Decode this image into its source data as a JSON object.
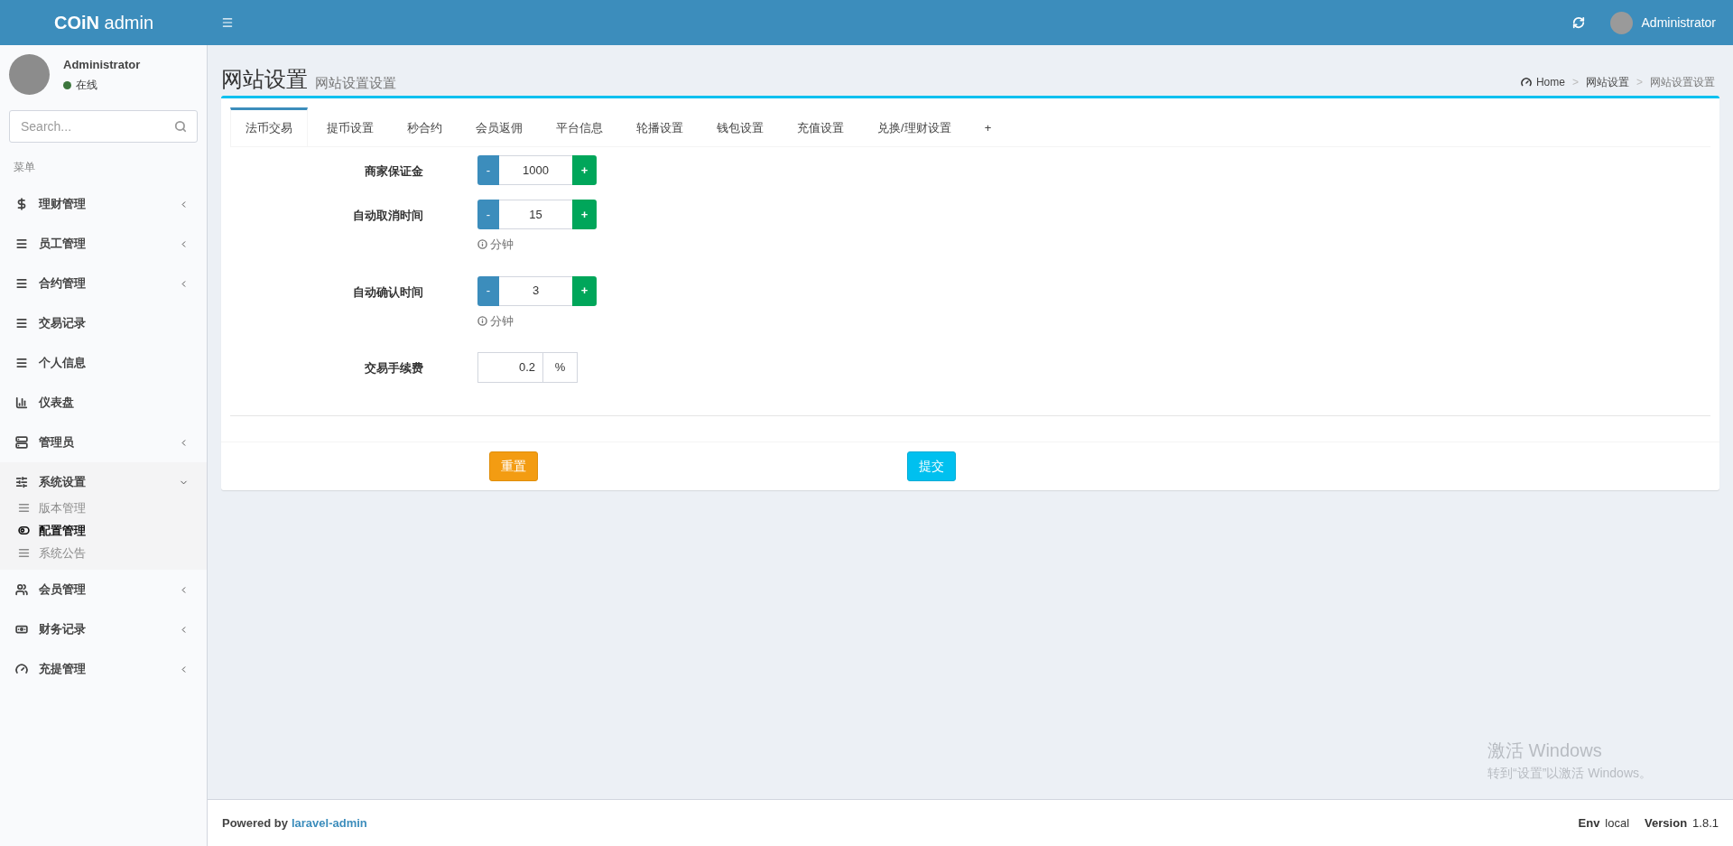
{
  "header": {
    "logo_bold": "COiN",
    "logo_text": "admin",
    "user": "Administrator"
  },
  "sidebar": {
    "user": {
      "name": "Administrator",
      "status": "在线",
      "online": true
    },
    "search": {
      "placeholder": "Search..."
    },
    "menu_heading": "菜单",
    "items": [
      {
        "label": "理财管理",
        "expanded": false
      },
      {
        "label": "员工管理",
        "expanded": false
      },
      {
        "label": "合约管理",
        "expanded": false
      },
      {
        "label": "交易记录"
      },
      {
        "label": "个人信息"
      },
      {
        "label": "仪表盘"
      },
      {
        "label": "管理员",
        "expanded": false
      },
      {
        "label": "系统设置",
        "expanded": true,
        "children": [
          {
            "label": "版本管理",
            "selected": false
          },
          {
            "label": "配置管理",
            "selected": true
          },
          {
            "label": "系统公告",
            "selected": false
          }
        ]
      },
      {
        "label": "会员管理",
        "expanded": false
      },
      {
        "label": "财务记录",
        "expanded": false
      },
      {
        "label": "充提管理",
        "expanded": false
      }
    ]
  },
  "page": {
    "title": "网站设置",
    "subtitle": "网站设置设置",
    "breadcrumb": [
      {
        "label": "Home"
      },
      {
        "label": "网站设置"
      },
      {
        "label": "网站设置设置"
      }
    ],
    "breadcrumb_separators": [
      ">",
      ">"
    ]
  },
  "tabs": [
    {
      "label": "法币交易",
      "selected": true
    },
    {
      "label": "提币设置",
      "selected": false
    },
    {
      "label": "秒合约",
      "selected": false
    },
    {
      "label": "会员返佣",
      "selected": false
    },
    {
      "label": "平台信息",
      "selected": false
    },
    {
      "label": "轮播设置",
      "selected": false
    },
    {
      "label": "钱包设置",
      "selected": false
    },
    {
      "label": "充值设置",
      "selected": false
    },
    {
      "label": "兑换/理财设置",
      "selected": false
    },
    {
      "label": "+",
      "selected": false
    }
  ],
  "fields": [
    {
      "kind": "stepper",
      "label": "商家保证金",
      "value": "1000",
      "minus": "-",
      "plus": "+"
    },
    {
      "kind": "stepper",
      "label": "自动取消时间",
      "value": "15",
      "minus": "-",
      "plus": "+",
      "help": "分钟"
    },
    {
      "kind": "stepper",
      "label": "自动确认时间",
      "value": "3",
      "minus": "-",
      "plus": "+",
      "help": "分钟"
    },
    {
      "kind": "addon",
      "label": "交易手续费",
      "value": "0.2",
      "addon": "%"
    }
  ],
  "buttons": {
    "reset": "重置",
    "submit": "提交"
  },
  "os_notice": {
    "title": "激活 Windows",
    "text": "转到“设置”以激活 Windows。"
  },
  "footer": {
    "powered_by": "Powered by",
    "link": "laravel-admin",
    "env_label": "Env",
    "env": "local",
    "version_label": "Version",
    "version": "1.8.1"
  }
}
